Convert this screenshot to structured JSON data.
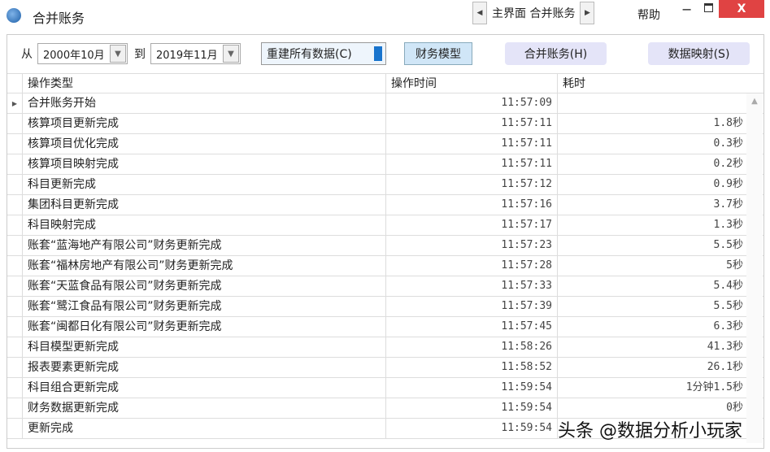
{
  "window": {
    "title": "合并账务",
    "nav_prev": "◀",
    "nav_text": "主界面 合并账务",
    "nav_next": "▶",
    "help": "帮助",
    "minimize": "−",
    "close": "X"
  },
  "toolbar": {
    "from_label": "从",
    "from_value": "2000年10月",
    "to_label": "到",
    "to_value": "2019年11月",
    "rebuild": "重建所有数据(C)",
    "model": "财务模型",
    "merge": "合并账务(H)",
    "mapping": "数据映射(S)"
  },
  "table": {
    "headers": [
      "操作类型",
      "操作时间",
      "耗时"
    ],
    "rows": [
      {
        "type": "合并账务开始",
        "time": "11:57:09",
        "dur": ""
      },
      {
        "type": "核算项目更新完成",
        "time": "11:57:11",
        "dur": "1.8秒"
      },
      {
        "type": "核算项目优化完成",
        "time": "11:57:11",
        "dur": "0.3秒"
      },
      {
        "type": "核算项目映射完成",
        "time": "11:57:11",
        "dur": "0.2秒"
      },
      {
        "type": "科目更新完成",
        "time": "11:57:12",
        "dur": "0.9秒"
      },
      {
        "type": "集团科目更新完成",
        "time": "11:57:16",
        "dur": "3.7秒"
      },
      {
        "type": "科目映射完成",
        "time": "11:57:17",
        "dur": "1.3秒"
      },
      {
        "type": "账套“蓝海地产有限公司”财务更新完成",
        "time": "11:57:23",
        "dur": "5.5秒"
      },
      {
        "type": "账套“福林房地产有限公司”财务更新完成",
        "time": "11:57:28",
        "dur": "5秒"
      },
      {
        "type": "账套“天蓝食品有限公司”财务更新完成",
        "time": "11:57:33",
        "dur": "5.4秒"
      },
      {
        "type": "账套“鹭江食品有限公司”财务更新完成",
        "time": "11:57:39",
        "dur": "5.5秒"
      },
      {
        "type": "账套“闽都日化有限公司”财务更新完成",
        "time": "11:57:45",
        "dur": "6.3秒"
      },
      {
        "type": "科目模型更新完成",
        "time": "11:58:26",
        "dur": "41.3秒"
      },
      {
        "type": "报表要素更新完成",
        "time": "11:58:52",
        "dur": "26.1秒"
      },
      {
        "type": "科目组合更新完成",
        "time": "11:59:54",
        "dur": "1分钟1.5秒"
      },
      {
        "type": "财务数据更新完成",
        "time": "11:59:54",
        "dur": "0秒"
      },
      {
        "type": "更新完成",
        "time": "11:59:54",
        "dur": ""
      }
    ]
  },
  "watermark": "头条 @数据分析小玩家"
}
